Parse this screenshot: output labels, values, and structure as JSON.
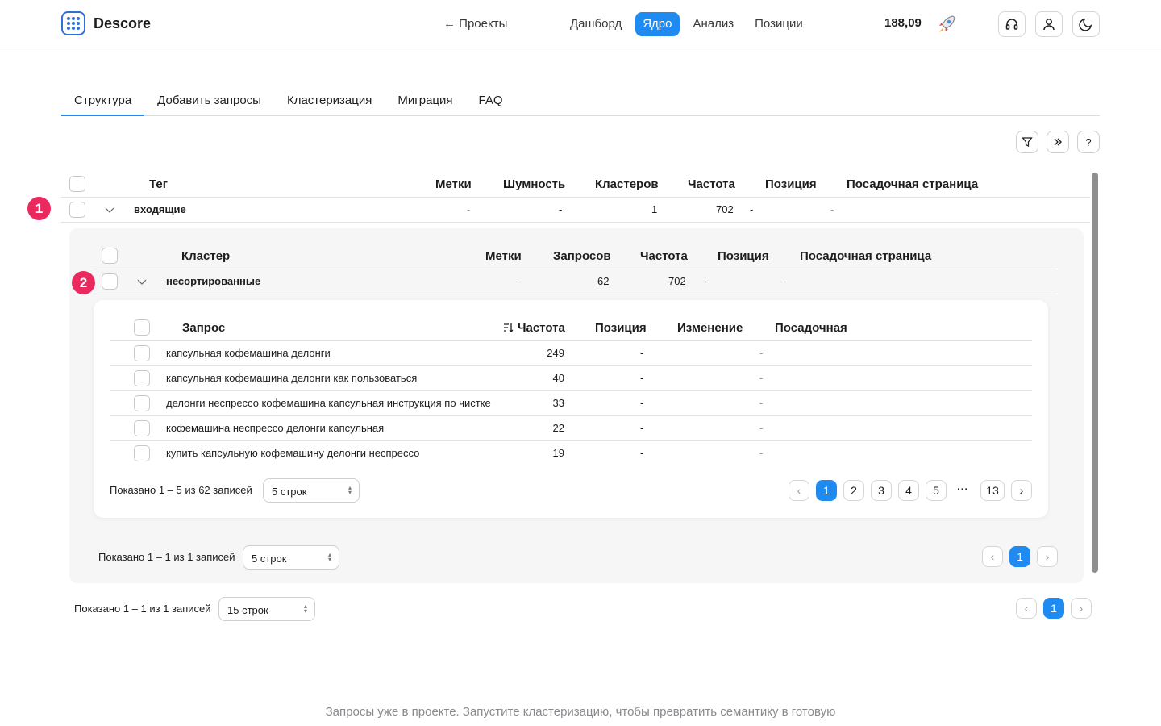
{
  "header": {
    "brand": "Descore",
    "back_link": "← Проекты",
    "nav": [
      "Дашборд",
      "Ядро",
      "Анализ",
      "Позиции"
    ],
    "active_nav": "Ядро",
    "balance": "188,09",
    "icons": [
      "headset-icon",
      "user-icon",
      "moon-icon"
    ]
  },
  "tabs": [
    "Структура",
    "Добавить запросы",
    "Кластеризация",
    "Миграция",
    "FAQ"
  ],
  "active_tab": "Структура",
  "toolbar": {
    "filter": "filter-icon",
    "expand": "double-chevron-icon",
    "help": "?"
  },
  "tag_table": {
    "headers": {
      "tag": "Тег",
      "labels": "Метки",
      "noise": "Шумность",
      "clusters": "Кластеров",
      "freq": "Частота",
      "pos": "Позиция",
      "landing": "Посадочная страница"
    },
    "row": {
      "marker": "1",
      "tag": "входящие",
      "labels": "-",
      "noise": "-",
      "clusters": "1",
      "freq": "702",
      "pos": "-",
      "landing": "-"
    },
    "footer": {
      "shown": "Показано 1 – 1 из 1 записей",
      "rows": "15 строк",
      "page": "1"
    }
  },
  "cluster_table": {
    "headers": {
      "cluster": "Кластер",
      "labels": "Метки",
      "queries": "Запросов",
      "freq": "Частота",
      "pos": "Позиция",
      "landing": "Посадочная страница"
    },
    "row": {
      "marker": "2",
      "cluster": "несортированные",
      "labels": "-",
      "queries": "62",
      "freq": "702",
      "pos": "-",
      "landing": "-"
    },
    "footer": {
      "shown": "Показано 1 – 1 из 1 записей",
      "rows": "5 строк",
      "page": "1"
    }
  },
  "query_table": {
    "headers": {
      "query": "Запрос",
      "freq": "Частота",
      "pos": "Позиция",
      "change": "Изменение",
      "landing": "Посадочная"
    },
    "rows": [
      {
        "query": "капсульная кофемашина делонги",
        "freq": "249",
        "pos": "-",
        "landing": "-"
      },
      {
        "query": "капсульная кофемашина делонги как пользоваться",
        "freq": "40",
        "pos": "-",
        "landing": "-"
      },
      {
        "query": "делонги неспрессо кофемашина капсульная инструкция по чистке",
        "freq": "33",
        "pos": "-",
        "landing": "-"
      },
      {
        "query": "кофемашина неспрессо делонги капсульная",
        "freq": "22",
        "pos": "-",
        "landing": "-"
      },
      {
        "query": "купить капсульную кофемашину делонги неспрессо",
        "freq": "19",
        "pos": "-",
        "landing": "-"
      }
    ],
    "footer": {
      "shown": "Показано 1 – 5 из 62 записей",
      "rows": "5 строк",
      "pages": [
        "1",
        "2",
        "3",
        "4",
        "5",
        "13"
      ],
      "ellipsis": "···"
    }
  },
  "bottom_note": "Запросы уже в проекте. Запустите кластеризацию, чтобы превратить семантику в готовую"
}
